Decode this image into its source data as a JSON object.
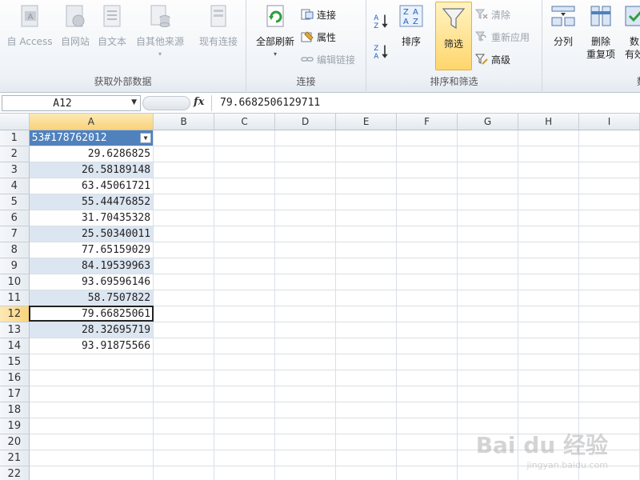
{
  "ribbon": {
    "external": {
      "label": "获取外部数据",
      "access": "自 Access",
      "web": "自网站",
      "text": "自文本",
      "other": "自其他来源",
      "existing": "现有连接"
    },
    "connections": {
      "label": "连接",
      "refresh_all": "全部刷新",
      "connections": "连接",
      "properties": "属性",
      "edit_links": "编辑链接"
    },
    "sort_filter": {
      "label": "排序和筛选",
      "sort": "排序",
      "filter": "筛选",
      "clear": "清除",
      "reapply": "重新应用",
      "advanced": "高级"
    },
    "tools": {
      "split": "分列",
      "remove_dup_1": "删除",
      "remove_dup_2": "重复项",
      "validation_1": "数",
      "validation_2": "有效",
      "group_label_partial": "数"
    }
  },
  "formula_bar": {
    "name_box": "A12",
    "fx": "fx",
    "value": "79.6682506129711"
  },
  "columns": [
    "A",
    "B",
    "C",
    "D",
    "E",
    "F",
    "G",
    "H",
    "I"
  ],
  "header_cell": "53#178762012",
  "values": [
    "29.6286825",
    "26.58189148",
    "63.45061721",
    "55.44476852",
    "31.70435328",
    "25.50340011",
    "77.65159029",
    "84.19539963",
    "93.69596146",
    "58.7507822",
    "79.66825061",
    "28.32695719",
    "93.91875566"
  ],
  "rows": [
    "1",
    "2",
    "3",
    "4",
    "5",
    "6",
    "7",
    "8",
    "9",
    "10",
    "11",
    "12",
    "13",
    "14",
    "15",
    "16",
    "17",
    "18",
    "19",
    "20",
    "21",
    "22"
  ],
  "watermark": {
    "main": "Bai du 经验",
    "sub": "jingyan.baidu.com"
  },
  "colors": {
    "accent": "#4f81bd",
    "band": "#dce6f1",
    "selected_header": "#f9d27a"
  }
}
